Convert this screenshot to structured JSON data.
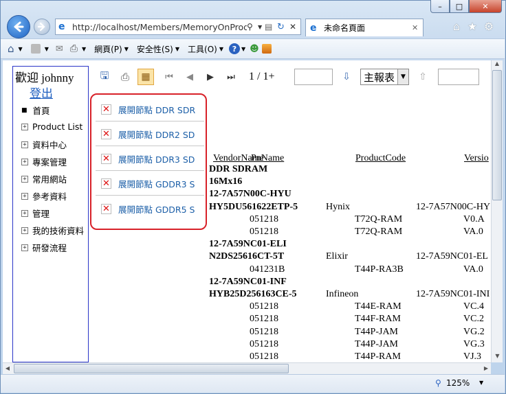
{
  "window": {
    "minimize_glyph": "–",
    "maximize_glyph": "□",
    "close_glyph": "✕"
  },
  "address_bar": {
    "url": "http://localhost/Members/MemoryOnProdu"
  },
  "tab": {
    "title": "未命名頁面"
  },
  "command_bar": {
    "page_menu": "網頁(P)",
    "safety_menu": "安全性(S)",
    "tools_menu": "工具(O)"
  },
  "sidebar": {
    "welcome": "歡迎 johnny",
    "logout": "登出",
    "items": [
      {
        "label": "首頁",
        "marker": "■"
      },
      {
        "label": "Product List",
        "marker": "+"
      },
      {
        "label": "資料中心",
        "marker": "+"
      },
      {
        "label": "專案管理",
        "marker": "+"
      },
      {
        "label": "常用網站",
        "marker": "+"
      },
      {
        "label": "參考資料",
        "marker": "+"
      },
      {
        "label": "管理",
        "marker": "+"
      },
      {
        "label": "我的技術資料",
        "marker": "+"
      },
      {
        "label": "研發流程",
        "marker": "+"
      }
    ]
  },
  "report_toolbar": {
    "page_indicator": "1 / 1+",
    "report_select": "主報表"
  },
  "expand_popup": {
    "items": [
      "展開節點 DDR SDR",
      "展開節點 DDR2 SD",
      "展開節點 DDR3 SD",
      "展開節點 GDDR3 S",
      "展開節點 GDDR5 S"
    ]
  },
  "report": {
    "headers": {
      "vendor_name": "VendorName",
      "pn_name": "PnName",
      "product_code": "ProductCode",
      "version": "Versio"
    },
    "lines": [
      {
        "type": "group",
        "text": "DDR SDRAM"
      },
      {
        "type": "group",
        "text": "16Mx16"
      },
      {
        "type": "group",
        "text": "12-7A57N00C-HYU"
      },
      {
        "type": "part",
        "pn": "HY5DU561622ETP-5",
        "vendor": "Hynix",
        "code": "12-7A57N00C-HY"
      },
      {
        "type": "row",
        "date": "051218",
        "product": "T72Q-RAM",
        "version": "V0.A"
      },
      {
        "type": "row",
        "date": "051218",
        "product": "T72Q-RAM",
        "version": "VA.0"
      },
      {
        "type": "group",
        "text": "12-7A59NC01-ELI"
      },
      {
        "type": "part",
        "pn": "N2DS25616CT-5T",
        "vendor": "Elixir",
        "code": "12-7A59NC01-EL"
      },
      {
        "type": "row",
        "date": "041231B",
        "product": "T44P-RA3B",
        "version": "VA.0"
      },
      {
        "type": "group",
        "text": "12-7A59NC01-INF"
      },
      {
        "type": "part",
        "pn": "HYB25D256163CE-5",
        "vendor": "Infineon",
        "code": "12-7A59NC01-INI"
      },
      {
        "type": "row",
        "date": "051218",
        "product": "T44E-RAM",
        "version": "VC.4"
      },
      {
        "type": "row",
        "date": "051218",
        "product": "T44F-RAM",
        "version": "VC.2"
      },
      {
        "type": "row",
        "date": "051218",
        "product": "T44P-JAM",
        "version": "VG.2"
      },
      {
        "type": "row",
        "date": "051218",
        "product": "T44P-JAM",
        "version": "VG.3"
      },
      {
        "type": "row",
        "date": "051218",
        "product": "T44P-RAM",
        "version": "VJ.3"
      }
    ]
  },
  "status_bar": {
    "zoom": "125%"
  }
}
